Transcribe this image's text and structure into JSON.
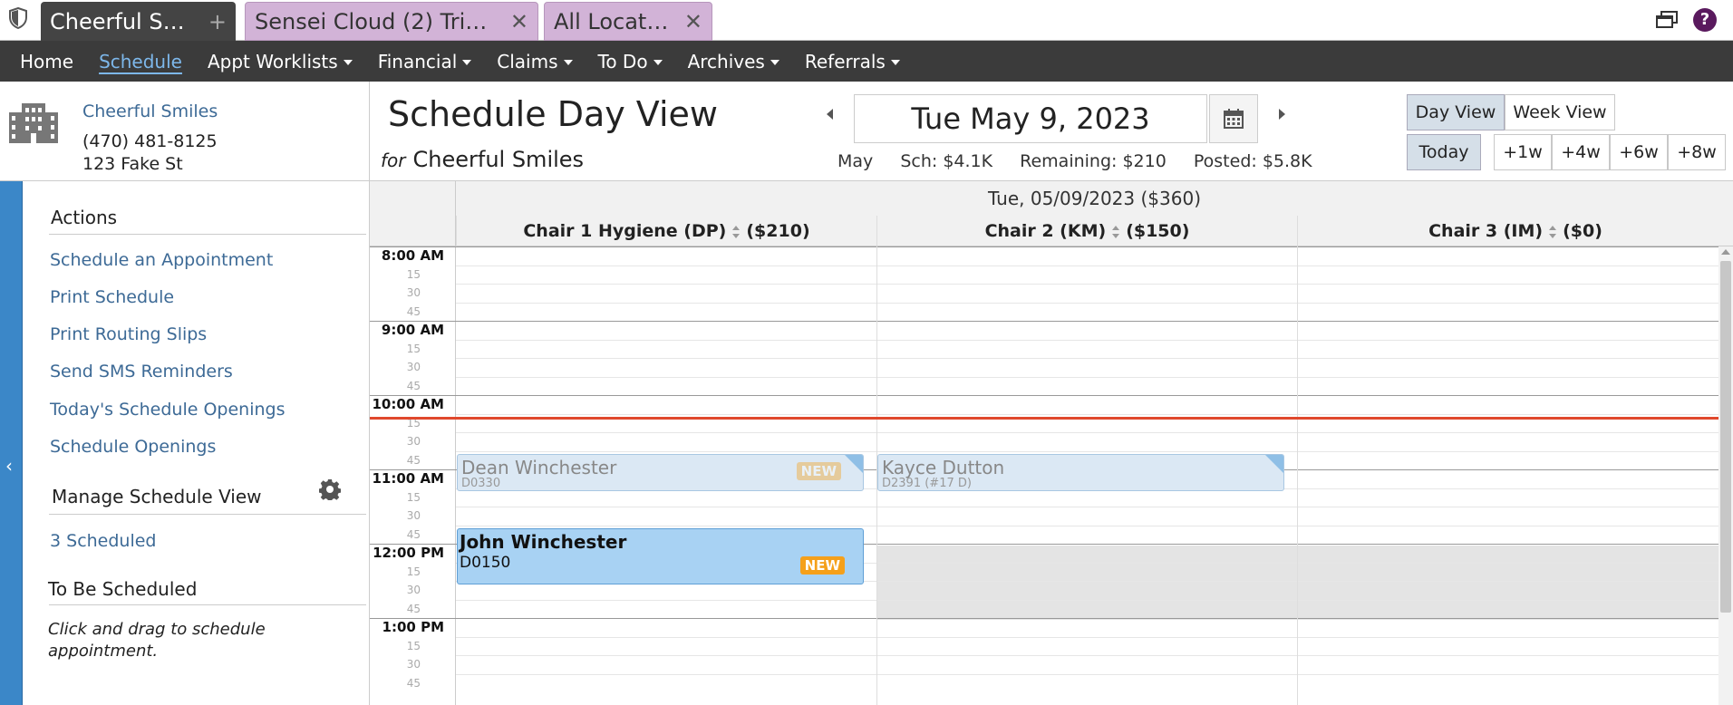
{
  "tabs": [
    {
      "label": "Cheerful Smiles",
      "action": "+"
    },
    {
      "label": "Sensei Cloud (2) Trial Sy...",
      "action": "✕"
    },
    {
      "label": "All Locations",
      "action": "✕"
    }
  ],
  "help_label": "?",
  "nav": [
    {
      "label": "Home",
      "dropdown": false
    },
    {
      "label": "Schedule",
      "dropdown": false,
      "active": true
    },
    {
      "label": "Appt Worklists",
      "dropdown": true
    },
    {
      "label": "Financial",
      "dropdown": true
    },
    {
      "label": "Claims",
      "dropdown": true
    },
    {
      "label": "To Do",
      "dropdown": true
    },
    {
      "label": "Archives",
      "dropdown": true
    },
    {
      "label": "Referrals",
      "dropdown": true
    }
  ],
  "location": {
    "name": "Cheerful Smiles",
    "phone": "(470) 481-8125",
    "address": "123 Fake St"
  },
  "header": {
    "title": "Schedule Day View",
    "for_label": "for",
    "for_name": "Cheerful Smiles",
    "date": "Tue May 9, 2023",
    "stats": {
      "month": "May",
      "scheduled": "Sch: $4.1K",
      "remaining": "Remaining: $210",
      "posted": "Posted: $5.8K"
    },
    "buttons": {
      "day_view": "Day View",
      "week_view": "Week View",
      "today": "Today",
      "plus1w": "+1w",
      "plus4w": "+4w",
      "plus6w": "+6w",
      "plus8w": "+8w"
    }
  },
  "sidebar": {
    "actions_heading": "Actions",
    "actions": [
      "Schedule an Appointment",
      "Print Schedule",
      "Print Routing Slips",
      "Send SMS Reminders",
      "Today's Schedule Openings",
      "Schedule Openings"
    ],
    "manage_heading": "Manage Schedule View",
    "scheduled_link": "3 Scheduled",
    "tbs_heading": "To Be Scheduled",
    "tbs_hint": "Click and drag to schedule appointment."
  },
  "schedule": {
    "day_header": "Tue, 05/09/2023 ($360)",
    "columns": [
      {
        "name": "Chair 1 Hygiene (DP)",
        "amount": "($210)"
      },
      {
        "name": "Chair 2 (KM)",
        "amount": "($150)"
      },
      {
        "name": "Chair 3 (IM)",
        "amount": "($0)"
      }
    ],
    "hours": [
      "8:00 AM",
      "9:00 AM",
      "10:00 AM",
      "11:00 AM",
      "12:00 PM",
      "1:00 PM"
    ],
    "minor_labels": [
      "15",
      "30",
      "45"
    ],
    "appointments": [
      {
        "patient": "Dean Winchester",
        "code": "D0330",
        "badge": "NEW"
      },
      {
        "patient": "Kayce Dutton",
        "code": "D2391 (#17 D)"
      },
      {
        "patient": "John Winchester",
        "code": "D0150",
        "badge": "NEW"
      }
    ]
  }
}
